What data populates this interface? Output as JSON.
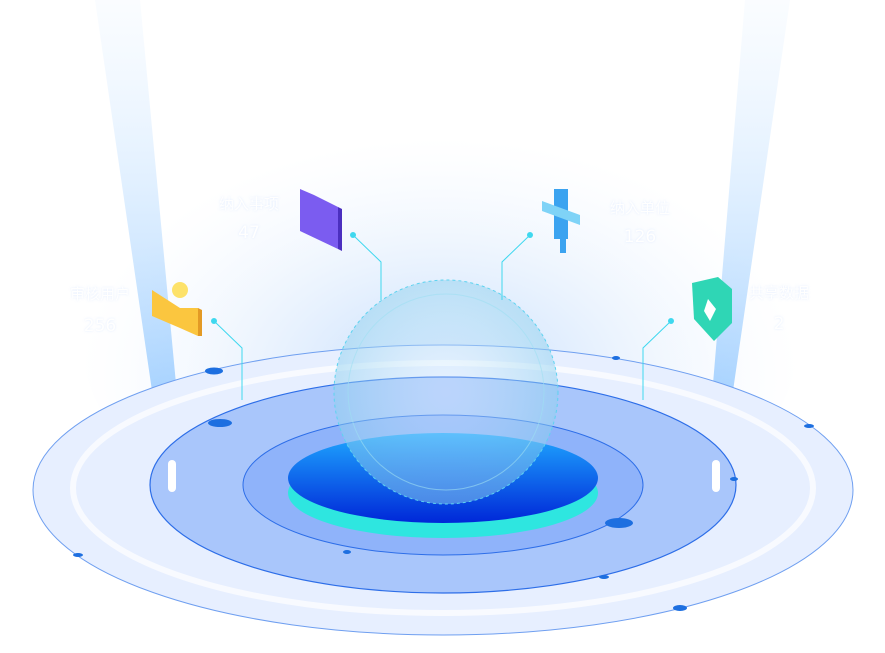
{
  "stats": [
    {
      "label": "审核用户",
      "value": "256",
      "icon": "user-hand-icon",
      "color": "#fbbf3a"
    },
    {
      "label": "纳入事项",
      "value": "47",
      "icon": "folder-icon",
      "color": "#7b5cf0"
    },
    {
      "label": "纳入单位",
      "value": "126",
      "icon": "organization-icon",
      "color": "#3ba3f0"
    },
    {
      "label": "共享数据",
      "value": "2",
      "icon": "shield-star-icon",
      "color": "#2fd6b5"
    }
  ],
  "colors": {
    "platform": "#0a5cf0",
    "ring": "#2d7df5",
    "glow": "#2ee6e0"
  }
}
